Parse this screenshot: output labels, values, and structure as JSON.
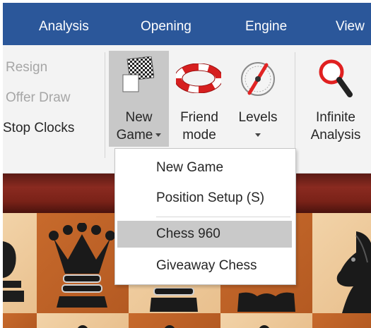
{
  "tabs": [
    "Analysis",
    "Opening",
    "Engine",
    "View"
  ],
  "ribbon": {
    "resign": "Resign",
    "offer_draw": "Offer Draw",
    "stop_clocks": "Stop Clocks",
    "new_game": {
      "line1": "New",
      "line2": "Game"
    },
    "friend_mode": {
      "line1": "Friend",
      "line2": "mode"
    },
    "levels": {
      "line1": "Levels"
    },
    "infinite_analysis": {
      "line1": "Infinite",
      "line2": "Analysis"
    }
  },
  "menu": {
    "items": [
      "New Game",
      "Position Setup (S)",
      "Chess 960",
      "Giveaway Chess"
    ]
  },
  "colors": {
    "tabbar": "#2b579a",
    "ribbon": "#f3f3f3",
    "pressed": "#c8c8c8",
    "menu_highlight": "#c9c9c9"
  }
}
